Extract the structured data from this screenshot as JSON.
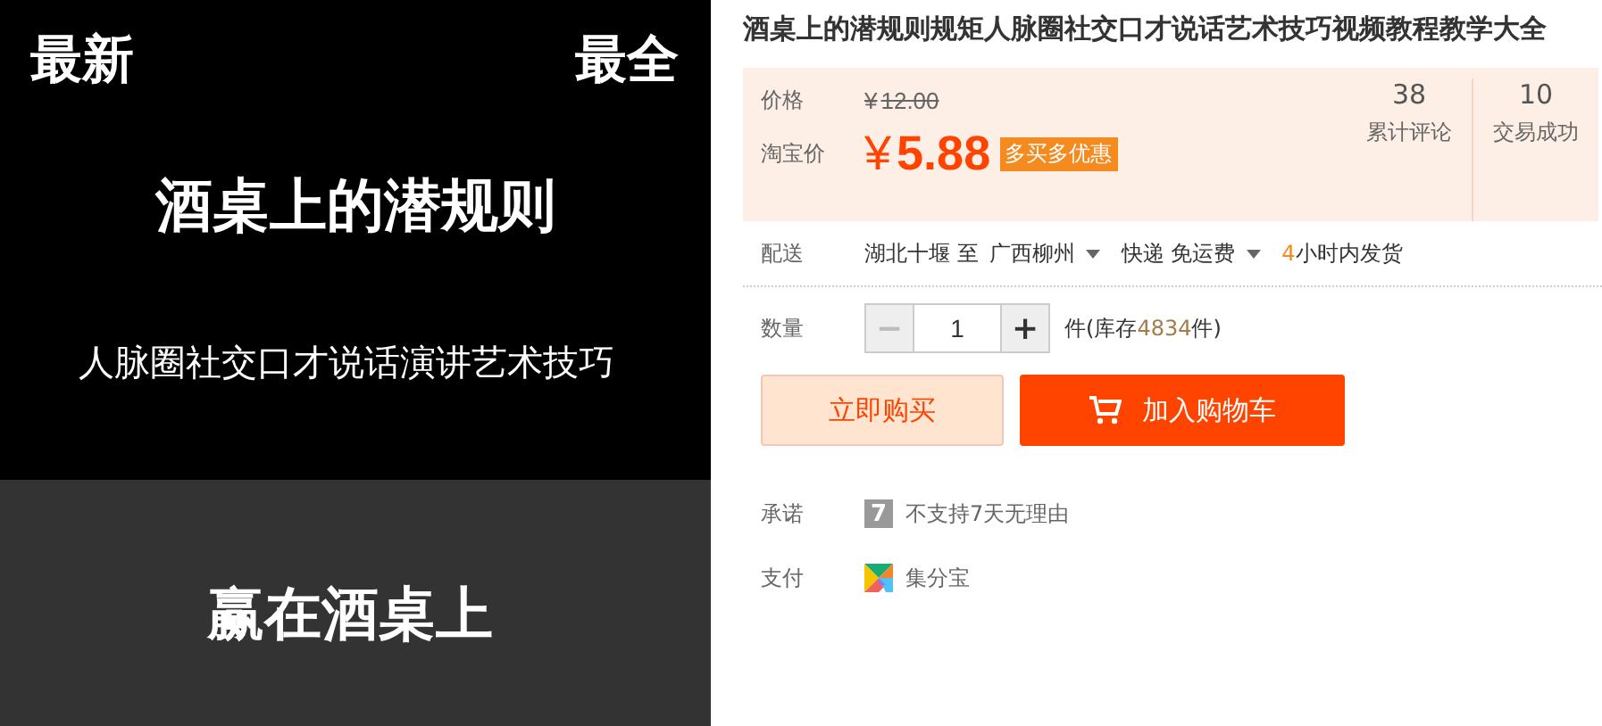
{
  "cover": {
    "corner_left": "最新",
    "corner_right": "最全",
    "headline": "酒桌上的潜规则",
    "subline": "人脉圈社交口才说话演讲艺术技巧",
    "footer": "赢在酒桌上"
  },
  "product": {
    "title": "酒桌上的潜规则规矩人脉圈社交口才说话艺术技巧视频教程教学大全"
  },
  "price": {
    "label": "价格",
    "currency": "¥",
    "original": "12.00",
    "promo_label": "淘宝价",
    "promo_currency": "¥",
    "promo": "5.88",
    "promo_tag": "多买多优惠"
  },
  "stats": [
    {
      "value": "38",
      "label": "累计评论"
    },
    {
      "value": "10",
      "label": "交易成功"
    }
  ],
  "delivery": {
    "label": "配送",
    "from": "湖北十堰 至",
    "to": "广西柳州",
    "method": "快递 免运费",
    "hours": "4",
    "dispatch": "小时内发货"
  },
  "quantity": {
    "label": "数量",
    "minus": "−",
    "value": "1",
    "plus": "+",
    "stock_prefix": "件(库存",
    "stock": "4834",
    "stock_suffix": "件)"
  },
  "buttons": [
    {
      "kind": "buy",
      "label": "立即购买"
    },
    {
      "kind": "cart",
      "label": "加入购物车"
    }
  ],
  "promise": {
    "label": "承诺",
    "badge": "7",
    "text": "不支持7天无理由"
  },
  "payment": {
    "label": "支付",
    "text": "集分宝"
  }
}
